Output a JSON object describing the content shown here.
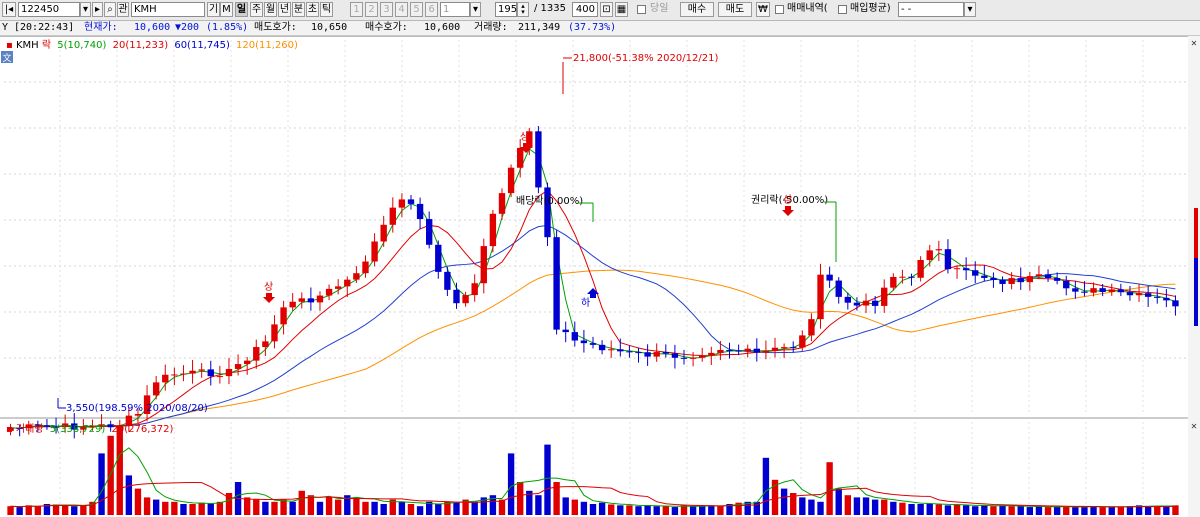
{
  "toolbar": {
    "code": "122450",
    "search_icon": "search-icon",
    "tab_label": "관",
    "name": "KMH",
    "periods": [
      "기",
      "M",
      "일",
      "주",
      "월",
      "년",
      "분",
      "초",
      "틱"
    ],
    "active_period": "일",
    "tick_numbers": [
      "1",
      "2",
      "3",
      "4",
      "5",
      "6"
    ],
    "tick_select": "1",
    "count": "195",
    "total": "/ 1335",
    "display": "400",
    "today_label": "당일",
    "buy_button": "매수",
    "sell_button": "매도",
    "trade_history_label": "매매내역(",
    "avg_price_label": "매입평균)",
    "account_select": "- -"
  },
  "status": {
    "time": "[20:22:43]",
    "current_label": "현재가:",
    "current_value": "10,600",
    "change": "▼200",
    "change_pct": "(1.85%)",
    "ask_label": "매도호가:",
    "ask_value": "10,650",
    "bid_label": "매수호가:",
    "bid_value": "10,600",
    "volume_label": "거래량:",
    "volume_value": "211,349",
    "volume_pct": "(37.73%)"
  },
  "price_legend": {
    "name": "KMH",
    "items": [
      {
        "text": "락",
        "color": "#e00000"
      },
      {
        "text": "5(10,740)",
        "color": "#00a000"
      },
      {
        "text": "20(11,233)",
        "color": "#e00000"
      },
      {
        "text": "60(11,745)",
        "color": "#0000d0"
      },
      {
        "text": "120(11,260)",
        "color": "#ff9000"
      }
    ]
  },
  "volume_legend": {
    "items": [
      {
        "text": "거래량",
        "color": "#e00000"
      },
      {
        "text": "5(338,729)",
        "color": "#00a000"
      },
      {
        "text": "20(276,372)",
        "color": "#e00000"
      }
    ]
  },
  "annotations": {
    "high": "21,800(-51.38% 2020/12/21)",
    "low": "3,550(198.59% 2020/08/20)",
    "dividend": "배당락(0.00%)",
    "rights": "권리락(-50.00%)",
    "up1": "상",
    "up2": "상",
    "up3": "상",
    "down1": "하"
  },
  "colors": {
    "up": "#e00000",
    "down": "#0000d0",
    "ma5": "#00a000",
    "ma20": "#e00000",
    "ma60": "#2040d0",
    "ma120": "#ff9000"
  },
  "chart_data": {
    "type": "candlestick",
    "price_waypoints": [
      [
        0,
        392
      ],
      [
        10,
        390
      ],
      [
        12,
        388
      ],
      [
        14,
        378
      ],
      [
        16,
        345
      ],
      [
        18,
        338
      ],
      [
        24,
        336
      ],
      [
        28,
        306
      ],
      [
        30,
        270
      ],
      [
        34,
        260
      ],
      [
        38,
        240
      ],
      [
        41,
        190
      ],
      [
        43,
        160
      ],
      [
        45,
        180
      ],
      [
        47,
        238
      ],
      [
        49,
        268
      ],
      [
        51,
        246
      ],
      [
        53,
        180
      ],
      [
        55,
        135
      ],
      [
        57,
        96
      ],
      [
        58,
        150
      ],
      [
        59,
        200
      ],
      [
        60,
        290
      ],
      [
        62,
        305
      ],
      [
        68,
        318
      ],
      [
        74,
        320
      ],
      [
        78,
        312
      ],
      [
        82,
        318
      ],
      [
        86,
        310
      ],
      [
        88,
        285
      ],
      [
        89,
        235
      ],
      [
        91,
        262
      ],
      [
        93,
        270
      ],
      [
        95,
        266
      ],
      [
        97,
        238
      ],
      [
        99,
        242
      ],
      [
        101,
        212
      ],
      [
        102,
        210
      ],
      [
        103,
        235
      ],
      [
        106,
        238
      ],
      [
        109,
        245
      ],
      [
        113,
        242
      ],
      [
        116,
        252
      ],
      [
        119,
        255
      ],
      [
        122,
        258
      ],
      [
        125,
        262
      ],
      [
        128,
        268
      ]
    ],
    "volume_values": [
      20,
      18,
      22,
      20,
      25,
      24,
      22,
      20,
      22,
      30,
      140,
      180,
      200,
      90,
      60,
      40,
      35,
      30,
      30,
      25,
      25,
      28,
      26,
      30,
      50,
      75,
      40,
      35,
      30,
      30,
      35,
      30,
      55,
      45,
      30,
      40,
      35,
      45,
      40,
      30,
      30,
      25,
      35,
      30,
      25,
      20,
      30,
      25,
      30,
      30,
      35,
      30,
      40,
      45,
      35,
      140,
      75,
      55,
      45,
      160,
      75,
      40,
      35,
      30,
      25,
      28,
      24,
      22,
      22,
      20,
      22,
      20,
      20,
      18,
      22,
      20,
      20,
      22,
      20,
      25,
      28,
      30,
      30,
      130,
      80,
      60,
      50,
      40,
      35,
      30,
      120,
      60,
      45,
      40,
      40,
      35,
      35,
      30,
      28,
      25,
      25,
      26,
      24,
      22,
      24,
      22,
      20,
      22,
      20,
      22,
      20,
      20,
      18,
      20,
      18,
      18,
      20,
      18,
      18,
      20,
      18,
      18,
      18,
      20,
      22,
      20,
      20,
      20,
      22
    ]
  }
}
